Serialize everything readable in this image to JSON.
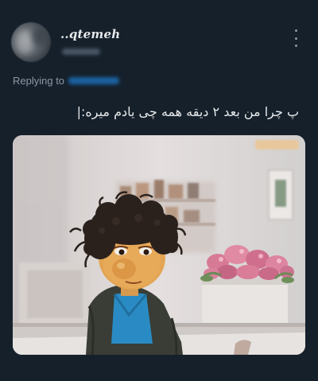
{
  "tweet": {
    "display_name": "..qtemeh",
    "replying_label": "Replying to",
    "text": "پ چرا من بعد ۲ دیقه همه چی یادم میره:|"
  },
  "icons": {
    "more": "more-vertical-icon"
  },
  "colors": {
    "background": "#15202b",
    "text_primary": "#e7e9ea",
    "text_secondary": "#8b98a5",
    "link": "#1d9bf0"
  }
}
